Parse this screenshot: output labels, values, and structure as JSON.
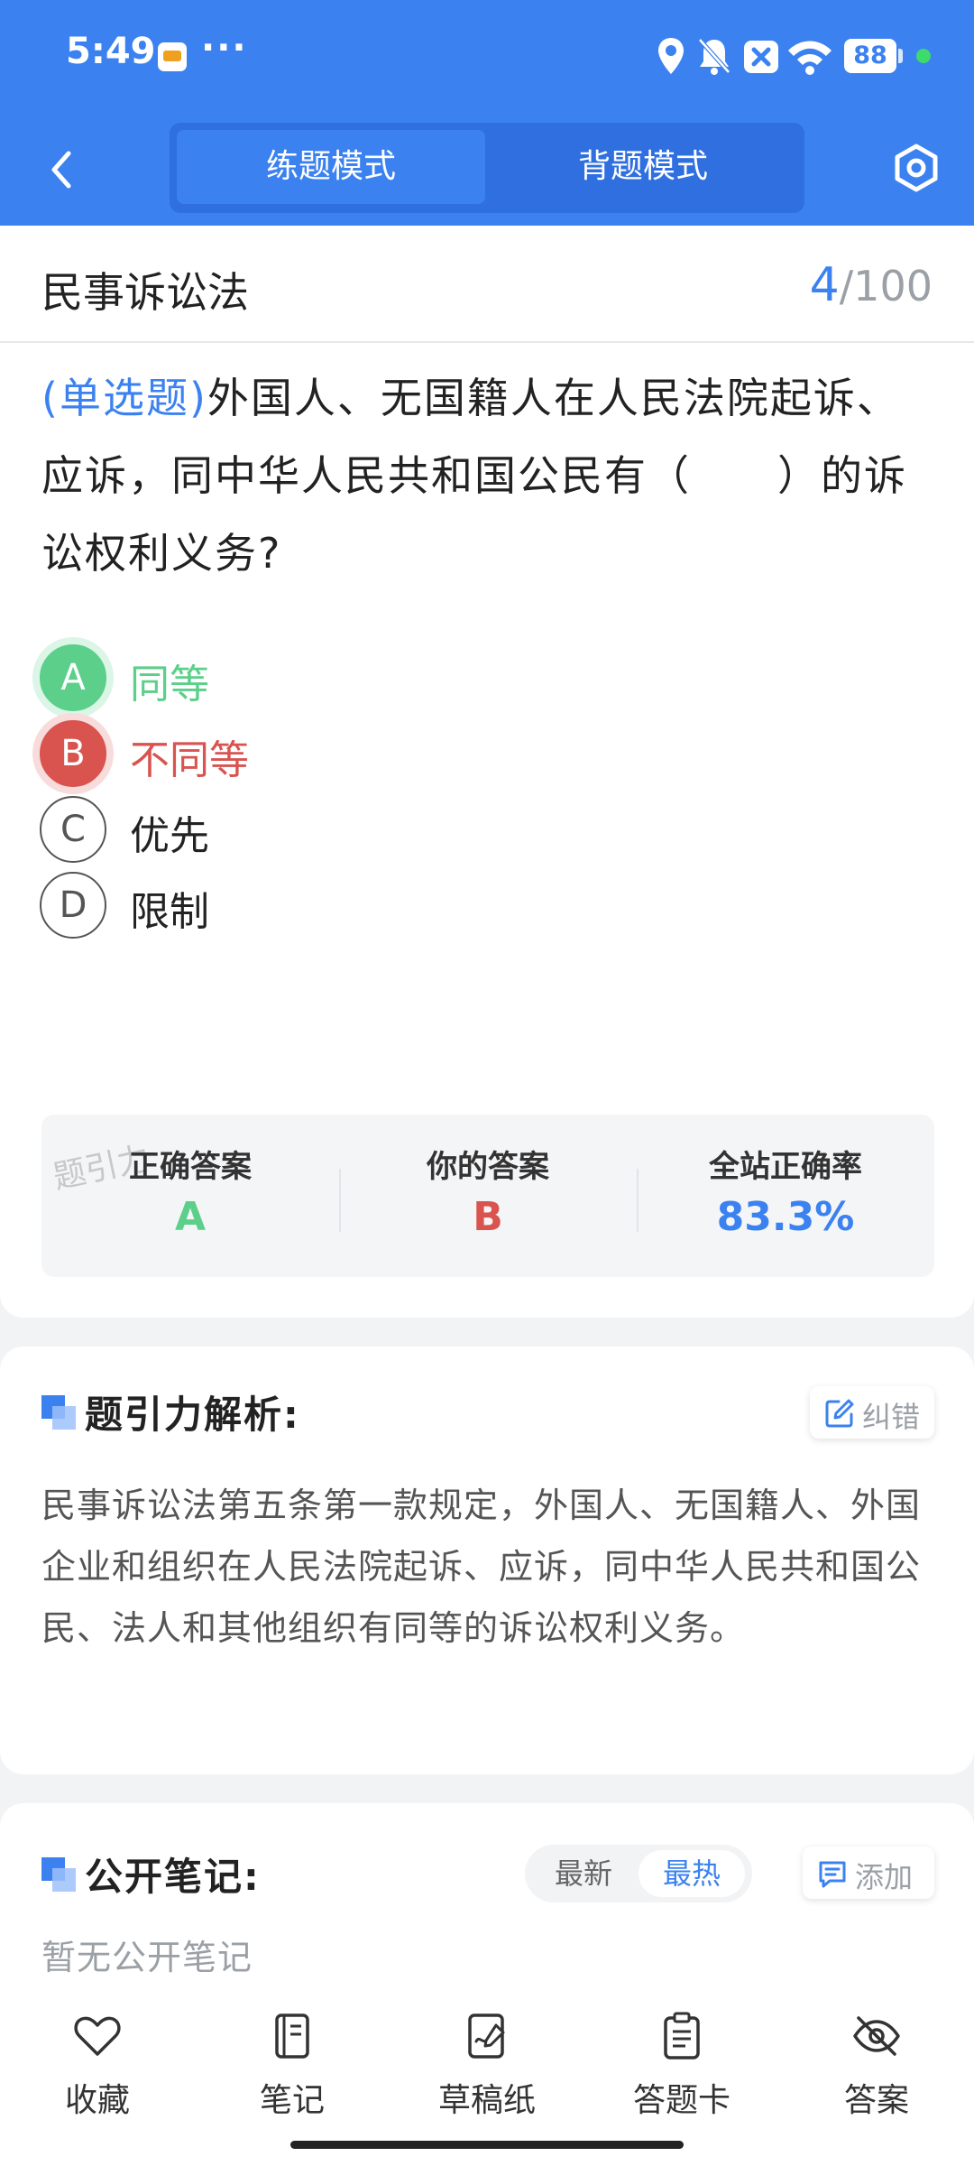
{
  "status_bar": {
    "time": "5:49",
    "more": "···",
    "battery": "88"
  },
  "nav": {
    "tabs": [
      {
        "label": "练题模式"
      },
      {
        "label": "背题模式"
      }
    ]
  },
  "header": {
    "subject": "民事诉讼法",
    "current": "4",
    "total": "/100"
  },
  "question": {
    "type": "(单选题)",
    "text": "外国人、无国籍人在人民法院起诉、应诉，同中华人民共和国公民有（　　）的诉讼权利义务?"
  },
  "options": [
    {
      "letter": "A",
      "text": "同等"
    },
    {
      "letter": "B",
      "text": "不同等"
    },
    {
      "letter": "C",
      "text": "优先"
    },
    {
      "letter": "D",
      "text": "限制"
    }
  ],
  "answer_panel": {
    "watermark": "题引力",
    "correct_label": "正确答案",
    "correct_value": "A",
    "yours_label": "你的答案",
    "yours_value": "B",
    "rate_label": "全站正确率",
    "rate_value": "83.3%"
  },
  "analysis": {
    "title": "题引力解析:",
    "report_label": "纠错",
    "text": "民事诉讼法第五条第一款规定，外国人、无国籍人、外国企业和组织在人民法院起诉、应诉，同中华人民共和国公民、法人和其他组织有同等的诉讼权利义务。"
  },
  "notes": {
    "title": "公开笔记:",
    "sort_options": [
      "最新",
      "最热"
    ],
    "add_label": "添加",
    "empty_text": "暂无公开笔记"
  },
  "toolbar": {
    "items": [
      "收藏",
      "笔记",
      "草稿纸",
      "答题卡",
      "答案"
    ]
  },
  "colors": {
    "primary": "#3b82f0",
    "correct": "#5ccf8a",
    "wrong": "#d9534f"
  }
}
